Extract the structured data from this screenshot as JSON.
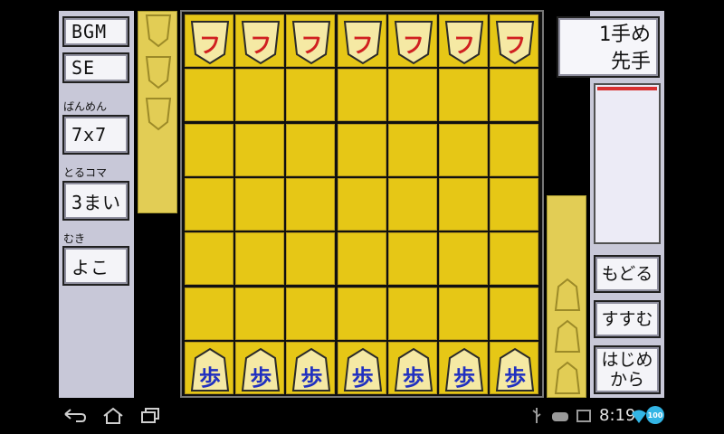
{
  "left_panel": {
    "bgm_label": "BGM",
    "se_label": "SE",
    "board_size_caption": "ばんめん",
    "board_size_value": "7x7",
    "capture_caption": "とるコマ",
    "capture_value": "3まい",
    "orientation_caption": "むき",
    "orientation_value": "よこ"
  },
  "status": {
    "move_number": "1手め",
    "current_player": "先手"
  },
  "right_panel": {
    "undo_label": "もどる",
    "redo_label": "すすむ",
    "restart_label_line1": "はじめ",
    "restart_label_line2": "から"
  },
  "board": {
    "rows": 7,
    "cols": 7,
    "top_pieces": [
      "フ",
      "フ",
      "フ",
      "フ",
      "フ",
      "フ",
      "フ"
    ],
    "bottom_pieces": [
      "歩",
      "歩",
      "歩",
      "歩",
      "歩",
      "歩",
      "歩"
    ],
    "top_piece_color": "#d02020",
    "bottom_piece_color": "#2030c0",
    "square_color": "#e6c716"
  },
  "trays": {
    "opponent_empty_slots": 3,
    "player_empty_slots": 3
  },
  "system_bar": {
    "time": "8:19",
    "battery_level": "100"
  }
}
